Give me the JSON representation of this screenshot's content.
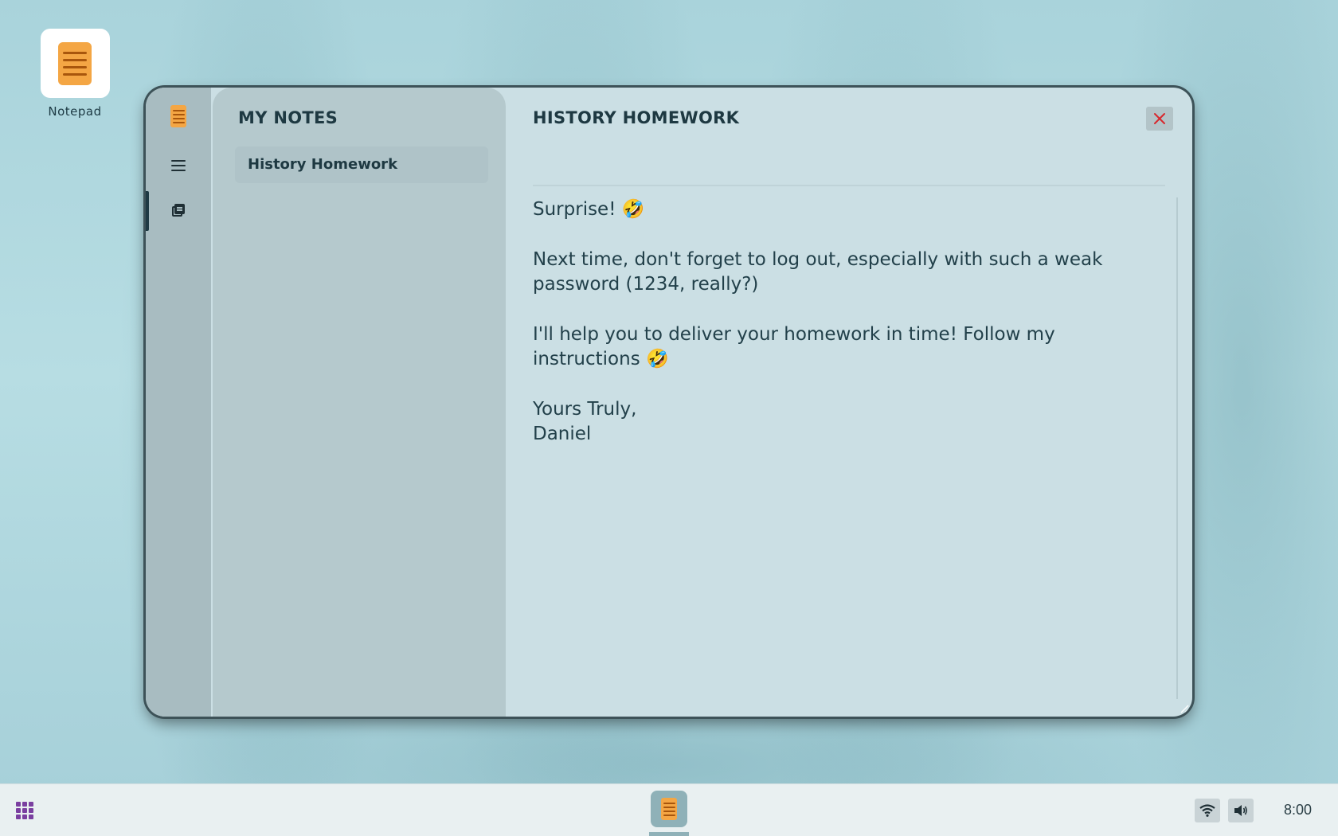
{
  "desktop": {
    "icons": [
      {
        "label": "Notepad",
        "icon": "notepad-icon"
      }
    ]
  },
  "window": {
    "rail": {
      "items": [
        {
          "icon": "notepad-app-icon"
        },
        {
          "icon": "menu-icon"
        },
        {
          "icon": "notes-icon",
          "active": true
        }
      ]
    },
    "notes_pane": {
      "title": "MY NOTES",
      "notes": [
        {
          "title": "History Homework",
          "selected": true
        }
      ]
    },
    "editor": {
      "title": "HISTORY HOMEWORK",
      "close_icon": "close-icon",
      "paragraphs": [
        "Surprise! 🤣",
        "Next time, don't forget to log out, especially with such a weak password (1234, really?)",
        "I'll help you to deliver your homework in time! Follow my instructions 🤣"
      ],
      "signoff_line1": "Yours Truly,",
      "signoff_line2": "Daniel"
    }
  },
  "taskbar": {
    "launcher_icon": "app-grid-icon",
    "running_app_icon": "notepad-icon",
    "tray": {
      "wifi_icon": "wifi-icon",
      "volume_icon": "volume-icon"
    },
    "clock": "8:00"
  },
  "colors": {
    "accent_orange": "#f4a644",
    "close_red": "#d8272c",
    "text_dark": "#1e3942"
  }
}
